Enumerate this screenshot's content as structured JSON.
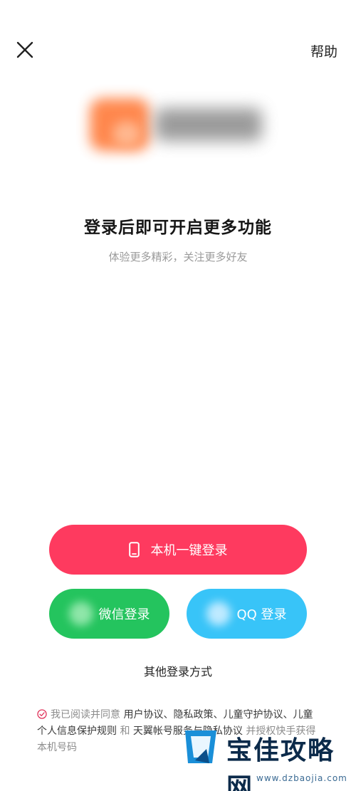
{
  "header": {
    "help_label": "帮助"
  },
  "main": {
    "headline": "登录后即可开启更多功能",
    "subtitle": "体验更多精彩，关注更多好友"
  },
  "login": {
    "phone_label": "本机一键登录",
    "wechat_label": "微信登录",
    "qq_label": "QQ 登录",
    "other_label": "其他登录方式"
  },
  "agreement": {
    "prefix": "我已阅读并同意 ",
    "user_agreement": "用户协议",
    "sep1": "、",
    "privacy_policy": "隐私政策",
    "sep2": "、",
    "child_protection": "儿童守护协议",
    "sep3": "、",
    "child_info": "儿童个人信息保护规则",
    "and": " 和 ",
    "tianyi": "天翼帐号服务与隐私协议",
    "suffix": " 并授权快手获得本机号码"
  },
  "watermark": {
    "title": "宝佳攻略网",
    "url": "www.dzbaojia.com"
  },
  "colors": {
    "phone_button": "#fe3a5f",
    "wechat_button": "#24c45e",
    "qq_button": "#38c4f8"
  },
  "icons": {
    "close": "close-icon",
    "phone": "phone-icon",
    "check": "check-circle-icon",
    "wechat": "wechat-icon",
    "qq": "qq-icon"
  }
}
